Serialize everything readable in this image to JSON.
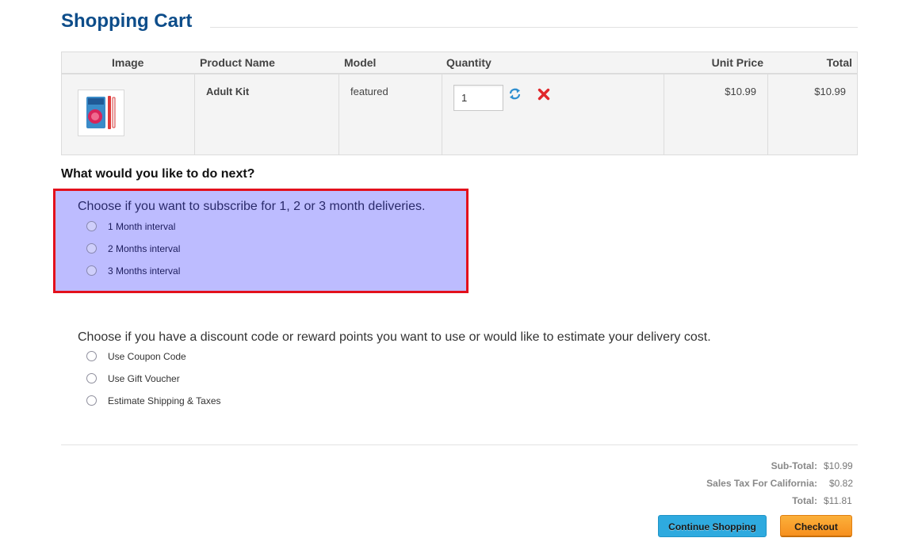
{
  "page": {
    "title": "Shopping Cart"
  },
  "cart": {
    "headers": {
      "image": "Image",
      "name": "Product Name",
      "model": "Model",
      "quantity": "Quantity",
      "unit_price": "Unit Price",
      "total": "Total"
    },
    "items": [
      {
        "image_icon": "product-thumbnail",
        "name": "Adult Kit",
        "model": "featured",
        "quantity": "1",
        "unit_price": "$10.99",
        "total": "$10.99",
        "update_icon": "refresh-icon",
        "remove_icon": "remove-icon"
      }
    ]
  },
  "next": {
    "heading": "What would you like to do next?",
    "subscription": {
      "prompt": "Choose if you want to subscribe for 1, 2 or 3 month deliveries.",
      "options": [
        "1 Month interval",
        "2 Months interval",
        "3 Months interval"
      ],
      "highlight_color": "#bdbcff",
      "border_color": "#e3101c"
    },
    "discount": {
      "prompt": "Choose if you have a discount code or reward points you want to use or would like to estimate your delivery cost.",
      "options": [
        "Use Coupon Code",
        "Use Gift Voucher",
        "Estimate Shipping & Taxes"
      ]
    }
  },
  "totals": [
    {
      "label": "Sub-Total:",
      "value": "$10.99"
    },
    {
      "label": "Sales Tax For California:",
      "value": "$0.82"
    },
    {
      "label": "Total:",
      "value": "$11.81"
    }
  ],
  "buttons": {
    "continue": "Continue Shopping",
    "checkout": "Checkout"
  },
  "colors": {
    "title": "#0d4d8a",
    "continue_button": "#2eaadf",
    "checkout_button": "#f7901e"
  }
}
